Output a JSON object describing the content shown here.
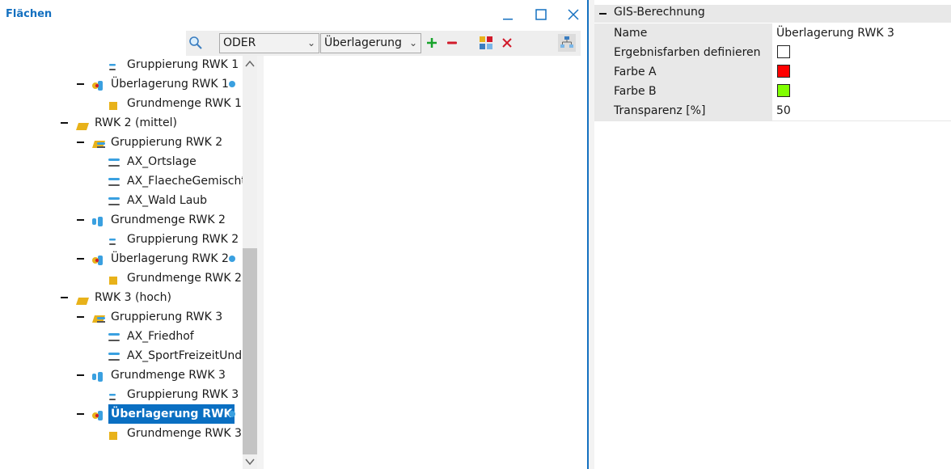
{
  "panel": {
    "title": "Flächen"
  },
  "toolbar": {
    "operator": "ODER",
    "layer": "Überlagerung",
    "add_symbol": "+",
    "delete_symbol": "✕"
  },
  "tree": {
    "items": [
      {
        "label": "Gruppierung RWK 1",
        "icon": "short-bars-icon"
      },
      {
        "label": "Überlagerung RWK 1",
        "icon": "overlay-icon"
      },
      {
        "label": "Grundmenge RWK 1",
        "icon": "yellow-square-icon"
      },
      {
        "label": "RWK 2 (mittel)",
        "icon": "folder-icon"
      },
      {
        "label": "Gruppierung RWK 2",
        "icon": "group-icon"
      },
      {
        "label": "AX_Ortslage",
        "icon": "layer-bars-icon"
      },
      {
        "label": "AX_FlaecheGemischte",
        "icon": "layer-bars-icon"
      },
      {
        "label": "AX_Wald Laub",
        "icon": "layer-bars-icon"
      },
      {
        "label": "Grundmenge RWK 2",
        "icon": "base-set-icon"
      },
      {
        "label": "Gruppierung RWK 2",
        "icon": "short-bars-icon"
      },
      {
        "label": "Überlagerung RWK 2",
        "icon": "overlay-icon"
      },
      {
        "label": "Grundmenge RWK 2",
        "icon": "yellow-square-icon"
      },
      {
        "label": "RWK 3 (hoch)",
        "icon": "folder-icon"
      },
      {
        "label": "Gruppierung RWK 3",
        "icon": "group-icon"
      },
      {
        "label": "AX_Friedhof",
        "icon": "layer-bars-icon"
      },
      {
        "label": "AX_SportFreizeitUndErholungsflaeche",
        "icon": "layer-bars-icon"
      },
      {
        "label": "Grundmenge RWK 3",
        "icon": "base-set-icon"
      },
      {
        "label": "Gruppierung RWK 3",
        "icon": "short-bars-icon"
      },
      {
        "label": "Überlagerung RWK",
        "icon": "overlay-icon"
      },
      {
        "label": "Grundmenge RWK 3",
        "icon": "yellow-square-icon"
      }
    ]
  },
  "properties": {
    "section": "GIS-Berechnung",
    "rows": [
      {
        "name": "Name",
        "value": "Überlagerung RWK 3"
      },
      {
        "name": "Ergebnisfarben definieren",
        "swatch": "#ffffff"
      },
      {
        "name": "Farbe A",
        "swatch": "#ff0000"
      },
      {
        "name": "Farbe B",
        "swatch": "#80ff00"
      },
      {
        "name": "Transparenz [%]",
        "value": "50"
      }
    ]
  },
  "colors": {
    "accent": "#1470c0",
    "selection": "#0a6fc2"
  }
}
